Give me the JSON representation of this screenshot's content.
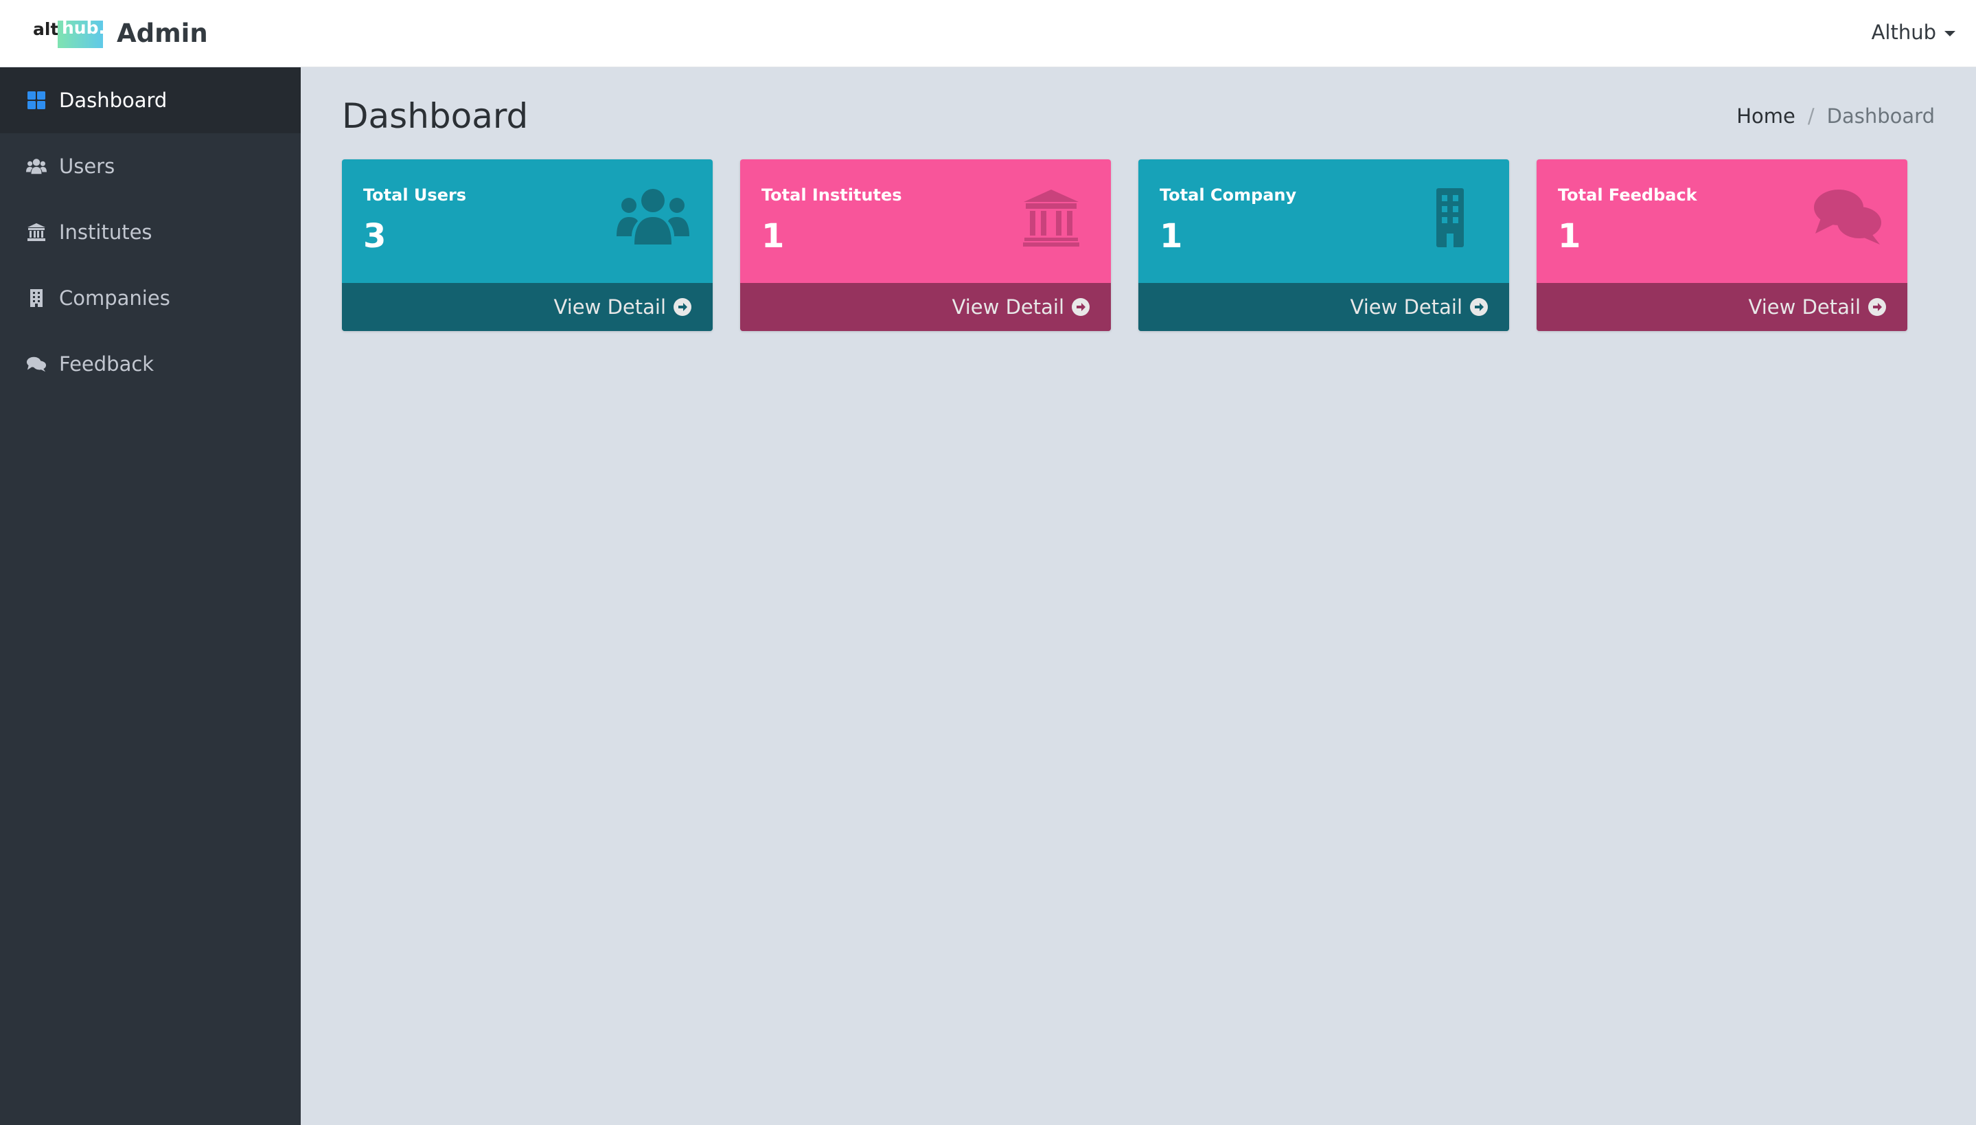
{
  "navbar": {
    "logo_alt": "alt",
    "logo_hub": "hub.",
    "title": "Admin",
    "user": "Althub"
  },
  "sidebar": {
    "items": [
      {
        "label": "Dashboard",
        "icon": "dashboard-icon",
        "active": true
      },
      {
        "label": "Users",
        "icon": "users-icon"
      },
      {
        "label": "Institutes",
        "icon": "institute-icon"
      },
      {
        "label": "Companies",
        "icon": "building-icon"
      },
      {
        "label": "Feedback",
        "icon": "comments-icon"
      }
    ]
  },
  "page": {
    "title": "Dashboard",
    "breadcrumb": {
      "home": "Home",
      "separator": "/",
      "current": "Dashboard"
    }
  },
  "cards": [
    {
      "label": "Total Users",
      "value": "3",
      "footer": "View Detail",
      "color": "#17a2b8",
      "icon": "users-icon"
    },
    {
      "label": "Total Institutes",
      "value": "1",
      "footer": "View Detail",
      "color": "#f8559a",
      "icon": "institute-icon"
    },
    {
      "label": "Total Company",
      "value": "1",
      "footer": "View Detail",
      "color": "#17a2b8",
      "icon": "building-icon"
    },
    {
      "label": "Total Feedback",
      "value": "1",
      "footer": "View Detail",
      "color": "#f8559a",
      "icon": "comments-icon"
    }
  ],
  "colors": {
    "sidebar_bg": "#2c333b",
    "content_bg": "#d9dfe7",
    "accent_blue": "#2e8ef0"
  }
}
